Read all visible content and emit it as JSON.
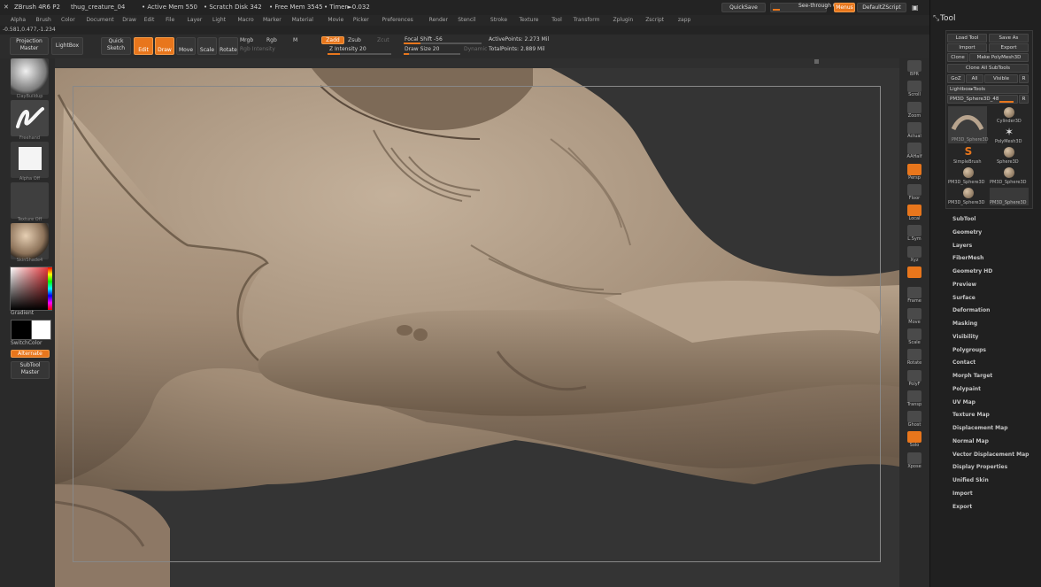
{
  "title_bar": {
    "app": "ZBrush 4R6 P2",
    "document": "thug_creature_04",
    "active_mem": "• Active Mem 550",
    "scratch_disk": "• Scratch Disk 342",
    "free_mem": "• Free Mem 3545",
    "timer": "• Timer►0.032",
    "quicksave": "QuickSave",
    "see_through": "See-through  0",
    "menus": "Menus",
    "default_zscript": "DefaultZScript"
  },
  "menu_bar": [
    "Alpha",
    "Brush",
    "Color",
    "Document",
    "Draw",
    "Edit",
    "File",
    "Layer",
    "Light",
    "Macro",
    "Marker",
    "Material",
    "Movie",
    "Picker",
    "Preferences",
    "Render",
    "Stencil",
    "Stroke",
    "Texture",
    "Tool",
    "Transform",
    "Zplugin",
    "Zscript",
    "zapp"
  ],
  "coords": "-0.581,0.477,-1.234",
  "toolbar": {
    "projection_master": "Projection Master",
    "lightbox": "LightBox",
    "quick_sketch": "Quick Sketch",
    "edit": "Edit",
    "draw": "Draw",
    "move": "Move",
    "scale": "Scale",
    "rotate": "Rotate",
    "mrgb": "Mrgb",
    "rgb": "Rgb",
    "m": "M",
    "rgb_intensity": "Rgb Intensity",
    "zadd": "Zadd",
    "zsub": "Zsub",
    "zcut": "Zcut",
    "z_intensity": "Z Intensity 20",
    "focal_shift": "Focal Shift -56",
    "draw_size": "Draw Size 20",
    "dynamic": "Dynamic",
    "active_points": "ActivePoints: 2.273  Mil",
    "total_points": "TotalPoints: 2.889  Mil"
  },
  "left_panel": {
    "brush_label": "ClayBuildup",
    "stroke_label": "Freehand",
    "alpha_label": "Alpha Off",
    "texture_label": "Texture Off",
    "material_label": "SkinShade4",
    "gradient": "Gradient",
    "switch_color": "SwitchColor",
    "alternate": "Alternate",
    "subtool_master": "SubTool Master",
    "main_color": "#000000",
    "secondary_color": "#ffffff"
  },
  "right_shelf": [
    "BPR",
    "Scroll",
    "Zoom",
    "Actual",
    "AAHalf",
    "Persp",
    "Floor",
    "Local",
    "L.Sym",
    "Xyz",
    "",
    "Frame",
    "Move",
    "Scale",
    "Rotate",
    "PolyF",
    "Transp",
    "Ghost",
    "Solo",
    "Xpose"
  ],
  "tool_tray": {
    "title": "Tool",
    "load_tool": "Load Tool",
    "save_as": "Save As",
    "import": "Import",
    "export": "Export",
    "clone": "Clone",
    "make_polymesh": "Make PolyMesh3D",
    "clone_all_subtools": "Clone All SubTools",
    "goz": "GoZ",
    "all": "All",
    "visible": "Visible",
    "r": "R",
    "lightbox_tools": "Lightbox▸Tools",
    "current_tool": "PM3D_Sphere3D_48",
    "tools": [
      "PM3D_Sphere3D",
      "Cylinder3D",
      "PolyMesh3D",
      "SimpleBrush",
      "Sphere3D",
      "PM3D_Sphere3D",
      "PM3D_Sphere3D",
      "PM3D_Sphere3D",
      "PM3D_Sphere3D"
    ],
    "items": [
      "SubTool",
      "Geometry",
      "Layers",
      "FiberMesh",
      "Geometry HD",
      "Preview",
      "Surface",
      "Deformation",
      "Masking",
      "Visibility",
      "Polygroups",
      "Contact",
      "Morph Target",
      "Polypaint",
      "UV Map",
      "Texture Map",
      "Displacement Map",
      "Normal Map",
      "Vector Displacement Map",
      "Display Properties",
      "Unified Skin",
      "Import",
      "Export"
    ]
  },
  "colors": {
    "accent": "#e8761c",
    "clay": "#a89580",
    "background": "#343434"
  }
}
